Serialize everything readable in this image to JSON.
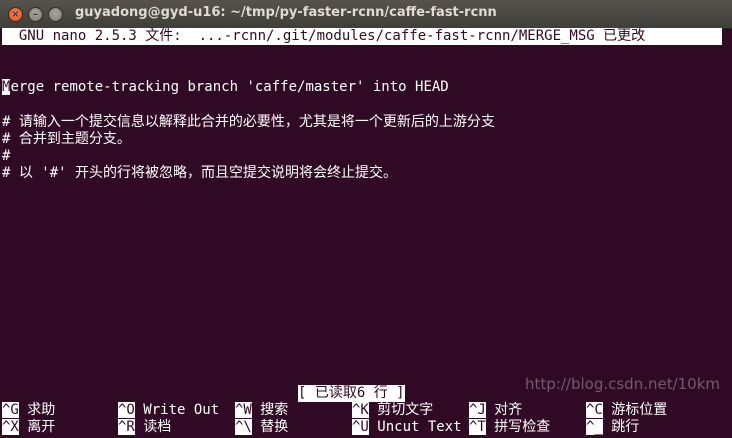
{
  "window": {
    "title": "guyadong@gyd-u16: ~/tmp/py-faster-rcnn/caffe-fast-rcnn",
    "close_glyph": "×",
    "min_glyph": "–",
    "max_glyph": ""
  },
  "nano": {
    "header": "  GNU nano 2.5.3 文件:  ...-rcnn/.git/modules/caffe-fast-rcnn/MERGE_MSG 已更改 ",
    "cursor_char": "M",
    "line1_rest": "erge remote-tracking branch 'caffe/master' into HEAD",
    "line3": "# 请输入一个提交信息以解释此合并的必要性，尤其是将一个更新后的上游分支",
    "line4": "# 合并到主题分支。",
    "line5": "#",
    "line6": "# 以 '#' 开头的行将被忽略，而且空提交说明将会终止提交。",
    "status": "[ 已读取6 行 ]",
    "shortcuts": [
      {
        "key": "^G",
        "label": "求助"
      },
      {
        "key": "^O",
        "label": "Write Out"
      },
      {
        "key": "^W",
        "label": "搜索"
      },
      {
        "key": "^K",
        "label": "剪切文字"
      },
      {
        "key": "^J",
        "label": "对齐"
      },
      {
        "key": "^C",
        "label": "游标位置"
      },
      {
        "key": "^X",
        "label": "离开"
      },
      {
        "key": "^R",
        "label": "读档"
      },
      {
        "key": "^\\",
        "label": "替换"
      },
      {
        "key": "^U",
        "label": "Uncut Text"
      },
      {
        "key": "^T",
        "label": "拼写检查"
      },
      {
        "key": "^_",
        "label": "跳行"
      }
    ]
  },
  "watermark": "http://blog.csdn.net/10km",
  "colors": {
    "terminal_bg": "#300a24",
    "foreground": "#ffffff"
  }
}
